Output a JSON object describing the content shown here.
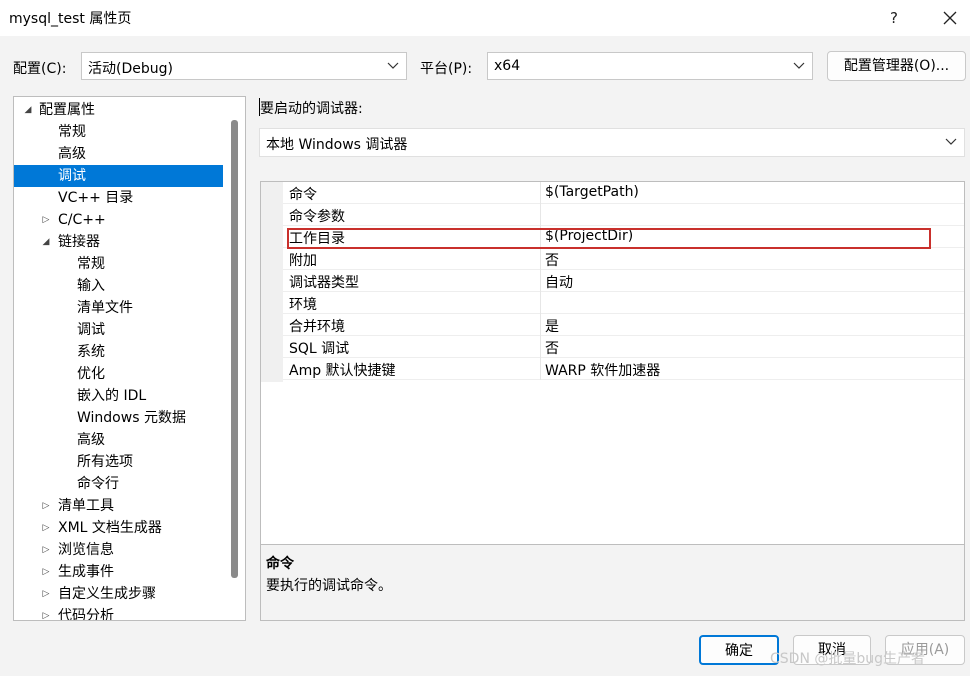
{
  "window": {
    "title": "mysql_test 属性页",
    "help_label": "?",
    "close_label": "✕"
  },
  "config_bar": {
    "config_label": "配置(C):",
    "config_value": "活动(Debug)",
    "platform_label": "平台(P):",
    "platform_value": "x64",
    "manager_button": "配置管理器(O)..."
  },
  "tree": {
    "items": [
      {
        "label": "配置属性",
        "arrow": "◢"
      },
      {
        "label": "常规",
        "arrow": ""
      },
      {
        "label": "高级",
        "arrow": ""
      },
      {
        "label": "调试",
        "arrow": ""
      },
      {
        "label": "VC++ 目录",
        "arrow": ""
      },
      {
        "label": "C/C++",
        "arrow": "▷"
      },
      {
        "label": "链接器",
        "arrow": "◢"
      },
      {
        "label": "常规",
        "arrow": ""
      },
      {
        "label": "输入",
        "arrow": ""
      },
      {
        "label": "清单文件",
        "arrow": ""
      },
      {
        "label": "调试",
        "arrow": ""
      },
      {
        "label": "系统",
        "arrow": ""
      },
      {
        "label": "优化",
        "arrow": ""
      },
      {
        "label": "嵌入的 IDL",
        "arrow": ""
      },
      {
        "label": "Windows 元数据",
        "arrow": ""
      },
      {
        "label": "高级",
        "arrow": ""
      },
      {
        "label": "所有选项",
        "arrow": ""
      },
      {
        "label": "命令行",
        "arrow": ""
      },
      {
        "label": "清单工具",
        "arrow": "▷"
      },
      {
        "label": "XML 文档生成器",
        "arrow": "▷"
      },
      {
        "label": "浏览信息",
        "arrow": "▷"
      },
      {
        "label": "生成事件",
        "arrow": "▷"
      },
      {
        "label": "自定义生成步骤",
        "arrow": "▷"
      },
      {
        "label": "代码分析",
        "arrow": "▷"
      }
    ]
  },
  "debugger": {
    "label": "要启动的调试器:",
    "value": "本地 Windows 调试器"
  },
  "properties": {
    "rows": [
      {
        "name": "命令",
        "value": "$(TargetPath)"
      },
      {
        "name": "命令参数",
        "value": ""
      },
      {
        "name": "工作目录",
        "value": "$(ProjectDir)"
      },
      {
        "name": "附加",
        "value": "否"
      },
      {
        "name": "调试器类型",
        "value": "自动"
      },
      {
        "name": "环境",
        "value": ""
      },
      {
        "name": "合并环境",
        "value": "是"
      },
      {
        "name": "SQL 调试",
        "value": "否"
      },
      {
        "name": "Amp 默认快捷键",
        "value": "WARP 软件加速器"
      }
    ]
  },
  "description": {
    "title": "命令",
    "text": "要执行的调试命令。"
  },
  "buttons": {
    "ok": "确定",
    "cancel": "取消",
    "apply": "应用(A)"
  },
  "watermark": "CSDN @批量bug生产者",
  "colors": {
    "selection": "#0078d7",
    "highlight_border": "#c9302c"
  }
}
